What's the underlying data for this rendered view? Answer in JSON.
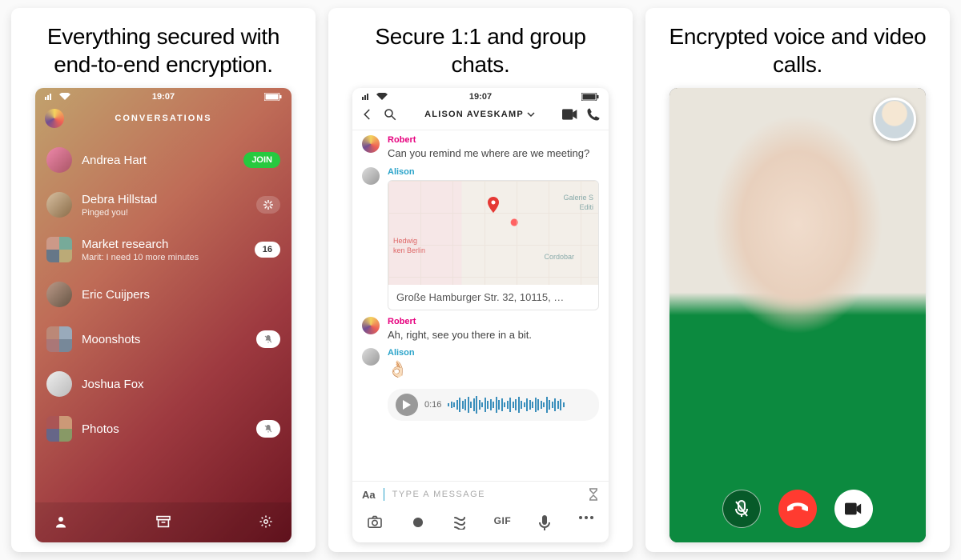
{
  "captions": {
    "c1": "Everything secured with end-to-end encryption.",
    "c2": "Secure 1:1 and group chats.",
    "c3": "Encrypted voice and video calls."
  },
  "status": {
    "time": "19:07"
  },
  "screen1": {
    "header_title": "CONVERSATIONS",
    "items": [
      {
        "name": "Andrea Hart",
        "sub": "",
        "badge": "JOIN",
        "badge_kind": "join"
      },
      {
        "name": "Debra Hillstad",
        "sub": "Pinged you!",
        "badge": "",
        "badge_kind": "spinner"
      },
      {
        "name": "Market research",
        "sub": "Marit: I need 10 more minutes",
        "badge": "16",
        "badge_kind": "count"
      },
      {
        "name": "Eric Cuijpers",
        "sub": "",
        "badge": "",
        "badge_kind": ""
      },
      {
        "name": "Moonshots",
        "sub": "",
        "badge": "",
        "badge_kind": "mute"
      },
      {
        "name": "Joshua Fox",
        "sub": "",
        "badge": "",
        "badge_kind": ""
      },
      {
        "name": "Photos",
        "sub": "",
        "badge": "",
        "badge_kind": "mute"
      }
    ]
  },
  "screen2": {
    "contact_name": "ALISON AVESKAMP",
    "messages": {
      "m1_name": "Robert",
      "m1_text": "Can you remind me where are we meeting?",
      "m2_name": "Alison",
      "m2_addr": "Große Hamburger Str. 32, 10115, …",
      "map_l1": "Hedwig",
      "map_l2": "ken Berlin",
      "map_r1": "Galerie S",
      "map_r2": "Editi",
      "map_r3": "Cordobar",
      "m3_name": "Robert",
      "m3_text": "Ah, right, see you there in a bit.",
      "m4_name": "Alison",
      "m4_emoji": "👌🏻"
    },
    "audio_time": "0:16",
    "input_placeholder": "TYPE A MESSAGE",
    "aa_label": "Aa",
    "gif_label": "GIF"
  }
}
